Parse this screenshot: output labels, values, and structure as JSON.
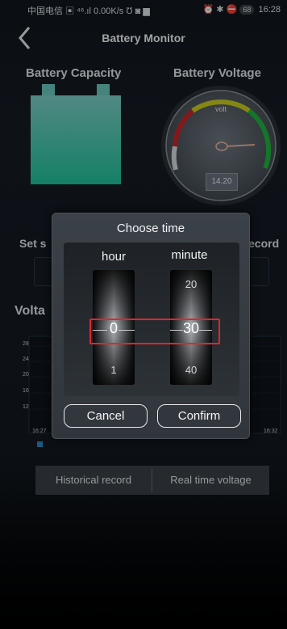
{
  "status_bar": {
    "carrier": "中国电信",
    "signal": "⁴⁶.ıl",
    "net_speed": "0.00K/s",
    "right_icons": "⏰ ✱ ⛔",
    "battery": "68",
    "time": "16:28"
  },
  "nav": {
    "title": "Battery Monitor"
  },
  "sections": {
    "capacity_title": "Battery Capacity",
    "voltage_title": "Battery Voltage",
    "set_label_partial": "Set s",
    "record_label_partial": "ecord",
    "voltage_chart_partial": "Volta"
  },
  "gauge": {
    "unit": "volt",
    "value": "14.20",
    "level": 14.2
  },
  "battery_fill_level": 0.85,
  "chart_data": {
    "type": "line",
    "y_ticks": [
      "28",
      "24",
      "20",
      "16",
      "12"
    ],
    "x_ticks": [
      "16:27",
      "16:32"
    ],
    "series": []
  },
  "bottom_buttons": {
    "historical": "Historical record",
    "realtime": "Real time voltage"
  },
  "dialog": {
    "title": "Choose time",
    "hour_label": "hour",
    "minute_label": "minute",
    "hour_selected": "0",
    "hour_next": "1",
    "minute_prev": "20",
    "minute_selected": "30",
    "minute_next": "40",
    "cancel": "Cancel",
    "confirm": "Confirm"
  },
  "colors": {
    "accent_teal": "#2ec49a",
    "highlight_red": "#e0262a",
    "legend_blue": "#2b88c7"
  }
}
